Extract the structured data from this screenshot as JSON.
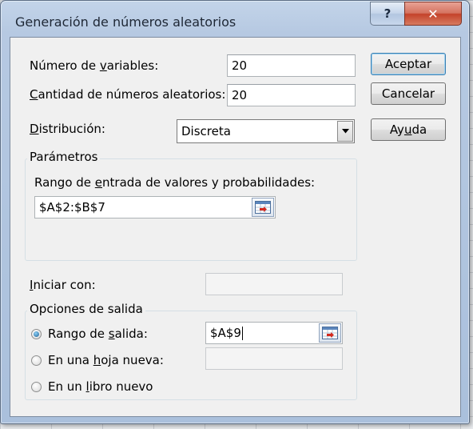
{
  "dialog": {
    "title": "Generación de números aleatorios",
    "help_button": "?",
    "close_button": "✕"
  },
  "fields": {
    "num_variables": {
      "label_pre": "Número de ",
      "label_key": "v",
      "label_post": "ariables:",
      "value": "20"
    },
    "cantidad": {
      "label_pre": "",
      "label_key": "C",
      "label_post": "antidad de números aleatorios:",
      "value": "20"
    },
    "distribucion": {
      "label_pre": "",
      "label_key": "D",
      "label_post": "istribución:",
      "value": "Discreta"
    }
  },
  "parametros": {
    "group_title": "Parámetros",
    "rango_label_pre": "Rango de ",
    "rango_label_key": "e",
    "rango_label_post": "ntrada de valores y probabilidades:",
    "rango_value": "$A$2:$B$7"
  },
  "iniciar": {
    "label_pre": "",
    "label_key": "I",
    "label_post": "niciar con:",
    "value": ""
  },
  "salida": {
    "group_title": "Opciones de salida",
    "options": [
      {
        "pre": "Rango de ",
        "key": "s",
        "post": "alida:",
        "selected": true,
        "value": "$A$9"
      },
      {
        "pre": "En una ",
        "key": "h",
        "post": "oja nueva:",
        "selected": false,
        "value": ""
      },
      {
        "pre": "En un ",
        "key": "l",
        "post": "ibro nuevo",
        "selected": false
      }
    ]
  },
  "buttons": {
    "aceptar": "Aceptar",
    "cancelar": "Cancelar",
    "ayuda_pre": "Ay",
    "ayuda_key": "u",
    "ayuda_post": "da"
  }
}
